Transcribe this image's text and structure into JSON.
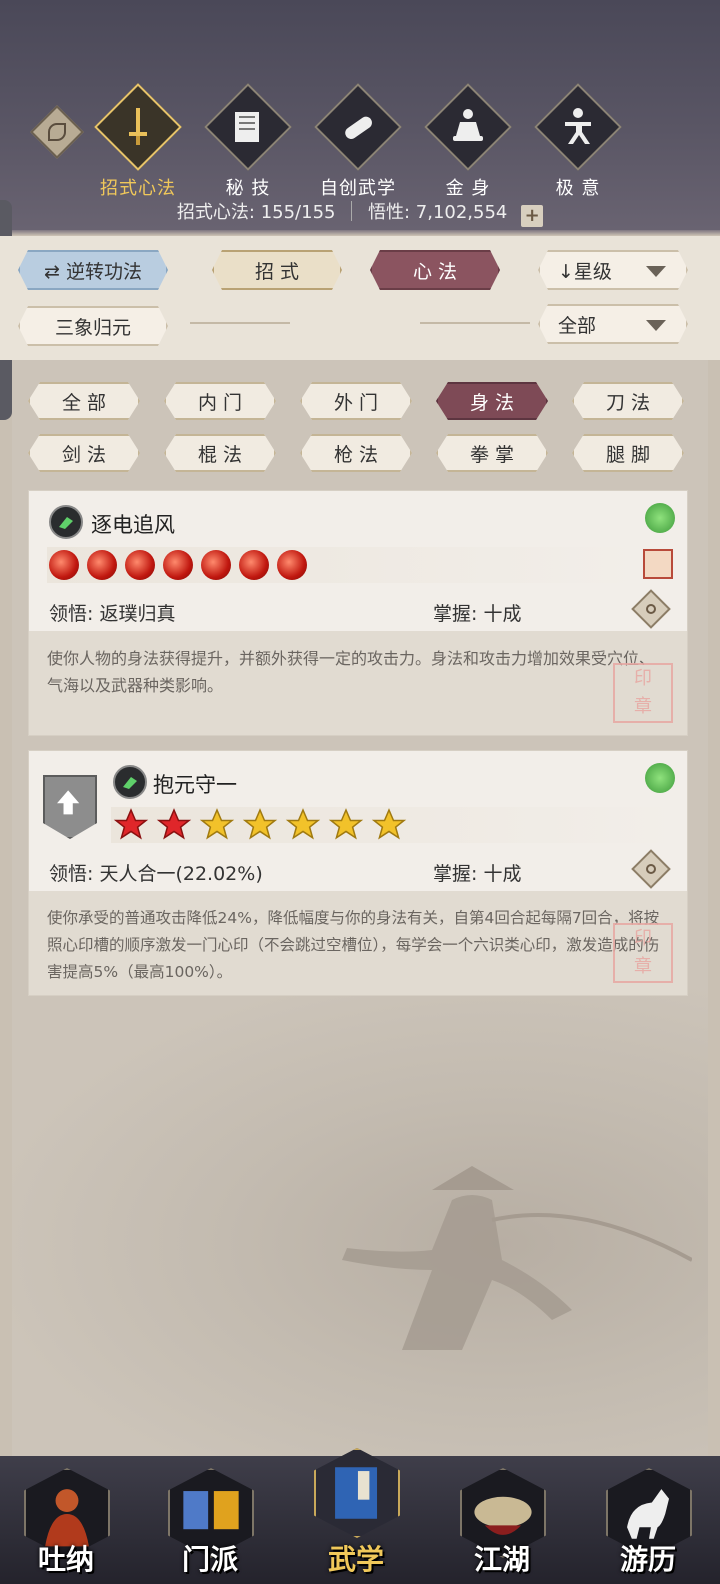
{
  "header": {
    "tabs": [
      {
        "label": "招式心法",
        "icon": "sword-icon",
        "active": true
      },
      {
        "label": "秘 技",
        "icon": "book-icon",
        "active": false
      },
      {
        "label": "自创武学",
        "icon": "scroll-icon",
        "active": false
      },
      {
        "label": "金 身",
        "icon": "meditation-icon",
        "active": false
      },
      {
        "label": "极 意",
        "icon": "martial-stance-icon",
        "active": false
      }
    ],
    "stats": {
      "moves_label": "招式心法:",
      "moves_value": "155/155",
      "insight_label": "悟性:",
      "insight_value": "7,102,554",
      "plus": "+"
    }
  },
  "controls": {
    "reverse_button": "逆转功法",
    "sanxiang_button": "三象归元",
    "tab_moves": "招 式",
    "tab_heart": "心 法",
    "sort_dropdown": "星级",
    "filter_dropdown": "全部"
  },
  "filters": {
    "items": [
      "全 部",
      "内 门",
      "外 门",
      "身 法",
      "刀 法",
      "剑 法",
      "棍 法",
      "枪 法",
      "拳 掌",
      "腿 脚"
    ],
    "active": "身 法"
  },
  "cards": [
    {
      "name": "逐电追风",
      "stars": 7,
      "star_type": "red-orb",
      "comprehension_label": "领悟:",
      "comprehension_value": "返璞归真",
      "mastery_label": "掌握:",
      "mastery_value": "十成",
      "description": "使你人物的身法获得提升，并额外获得一定的攻击力。身法和攻击力增加效果受穴位、气海以及武器种类影响。"
    },
    {
      "name": "抱元守一",
      "stars": 7,
      "red_stars": 2,
      "gold_stars": 5,
      "comprehension_label": "领悟:",
      "comprehension_value": "天人合一(22.02%)",
      "mastery_label": "掌握:",
      "mastery_value": "十成",
      "description": "使你承受的普通攻击降低24%，降低幅度与你的身法有关，自第4回合起每隔7回合，将按照心印槽的顺序激发一门心印（不会跳过空槽位），每学会一个六识类心印，激发造成的伤害提高5%（最高100%）。"
    }
  ],
  "bottom_nav": [
    {
      "label": "吐纳",
      "icon": "monk-icon",
      "active": false
    },
    {
      "label": "门派",
      "icon": "sect-banner-icon",
      "active": false
    },
    {
      "label": "武学",
      "icon": "martial-book-icon",
      "active": true
    },
    {
      "label": "江湖",
      "icon": "straw-hat-icon",
      "active": false
    },
    {
      "label": "游历",
      "icon": "horse-icon",
      "active": false
    }
  ]
}
